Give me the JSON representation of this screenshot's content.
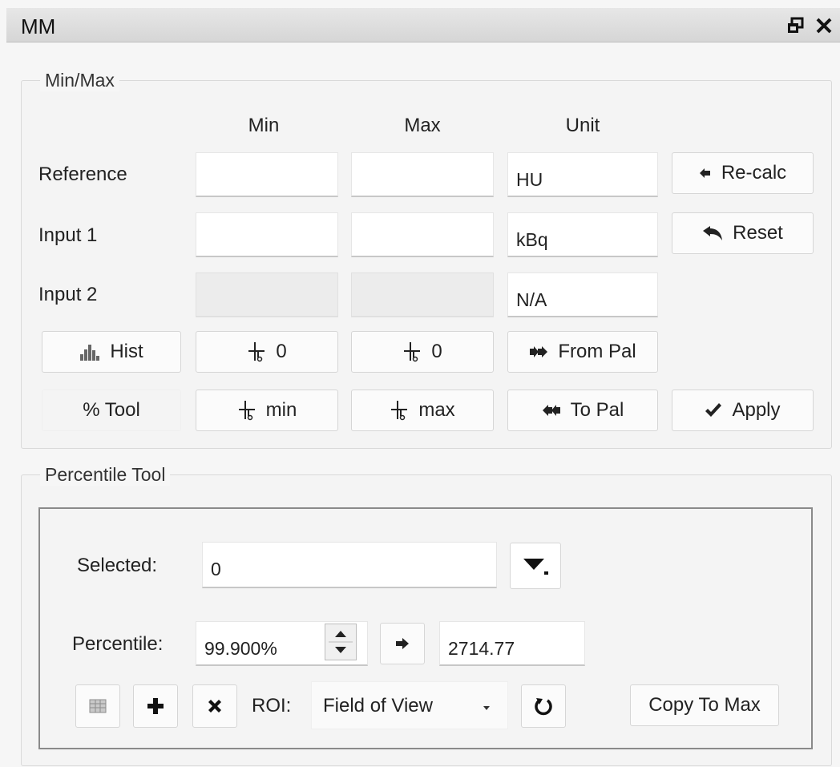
{
  "window": {
    "title": "MM",
    "restore_icon": "restore-window-icon",
    "close_icon": "close-icon"
  },
  "minmax": {
    "legend": "Min/Max",
    "columns": {
      "min": "Min",
      "max": "Max",
      "unit": "Unit"
    },
    "rows": {
      "reference": {
        "label": "Reference",
        "min": "",
        "max": "",
        "unit": "HU"
      },
      "input1": {
        "label": "Input 1",
        "min": "",
        "max": "",
        "unit": "kBq"
      },
      "input2": {
        "label": "Input 2",
        "min": "",
        "max": "",
        "unit": "N/A"
      }
    },
    "buttons": {
      "recalc": "Re-calc",
      "reset": "Reset",
      "hist": "Hist",
      "zero_min": "0",
      "zero_max": "0",
      "from_pal": "From Pal",
      "pct_tool": "% Tool",
      "set_min": "min",
      "set_max": "max",
      "to_pal": "To Pal",
      "apply": "Apply"
    }
  },
  "percentile_tool": {
    "legend": "Percentile Tool",
    "selected_label": "Selected:",
    "selected_value": "0",
    "percentile_label": "Percentile:",
    "percentile_value": "99.900%",
    "result_value": "2714.77",
    "roi_label": "ROI:",
    "roi_value": "Field of View",
    "copy_to_max": "Copy To Max"
  },
  "colors": {
    "titlebar": "#dcdcdc",
    "panel": "#f6f6f6",
    "field": "#ffffff",
    "disabled_field": "#ececec",
    "icon": "#222222"
  }
}
